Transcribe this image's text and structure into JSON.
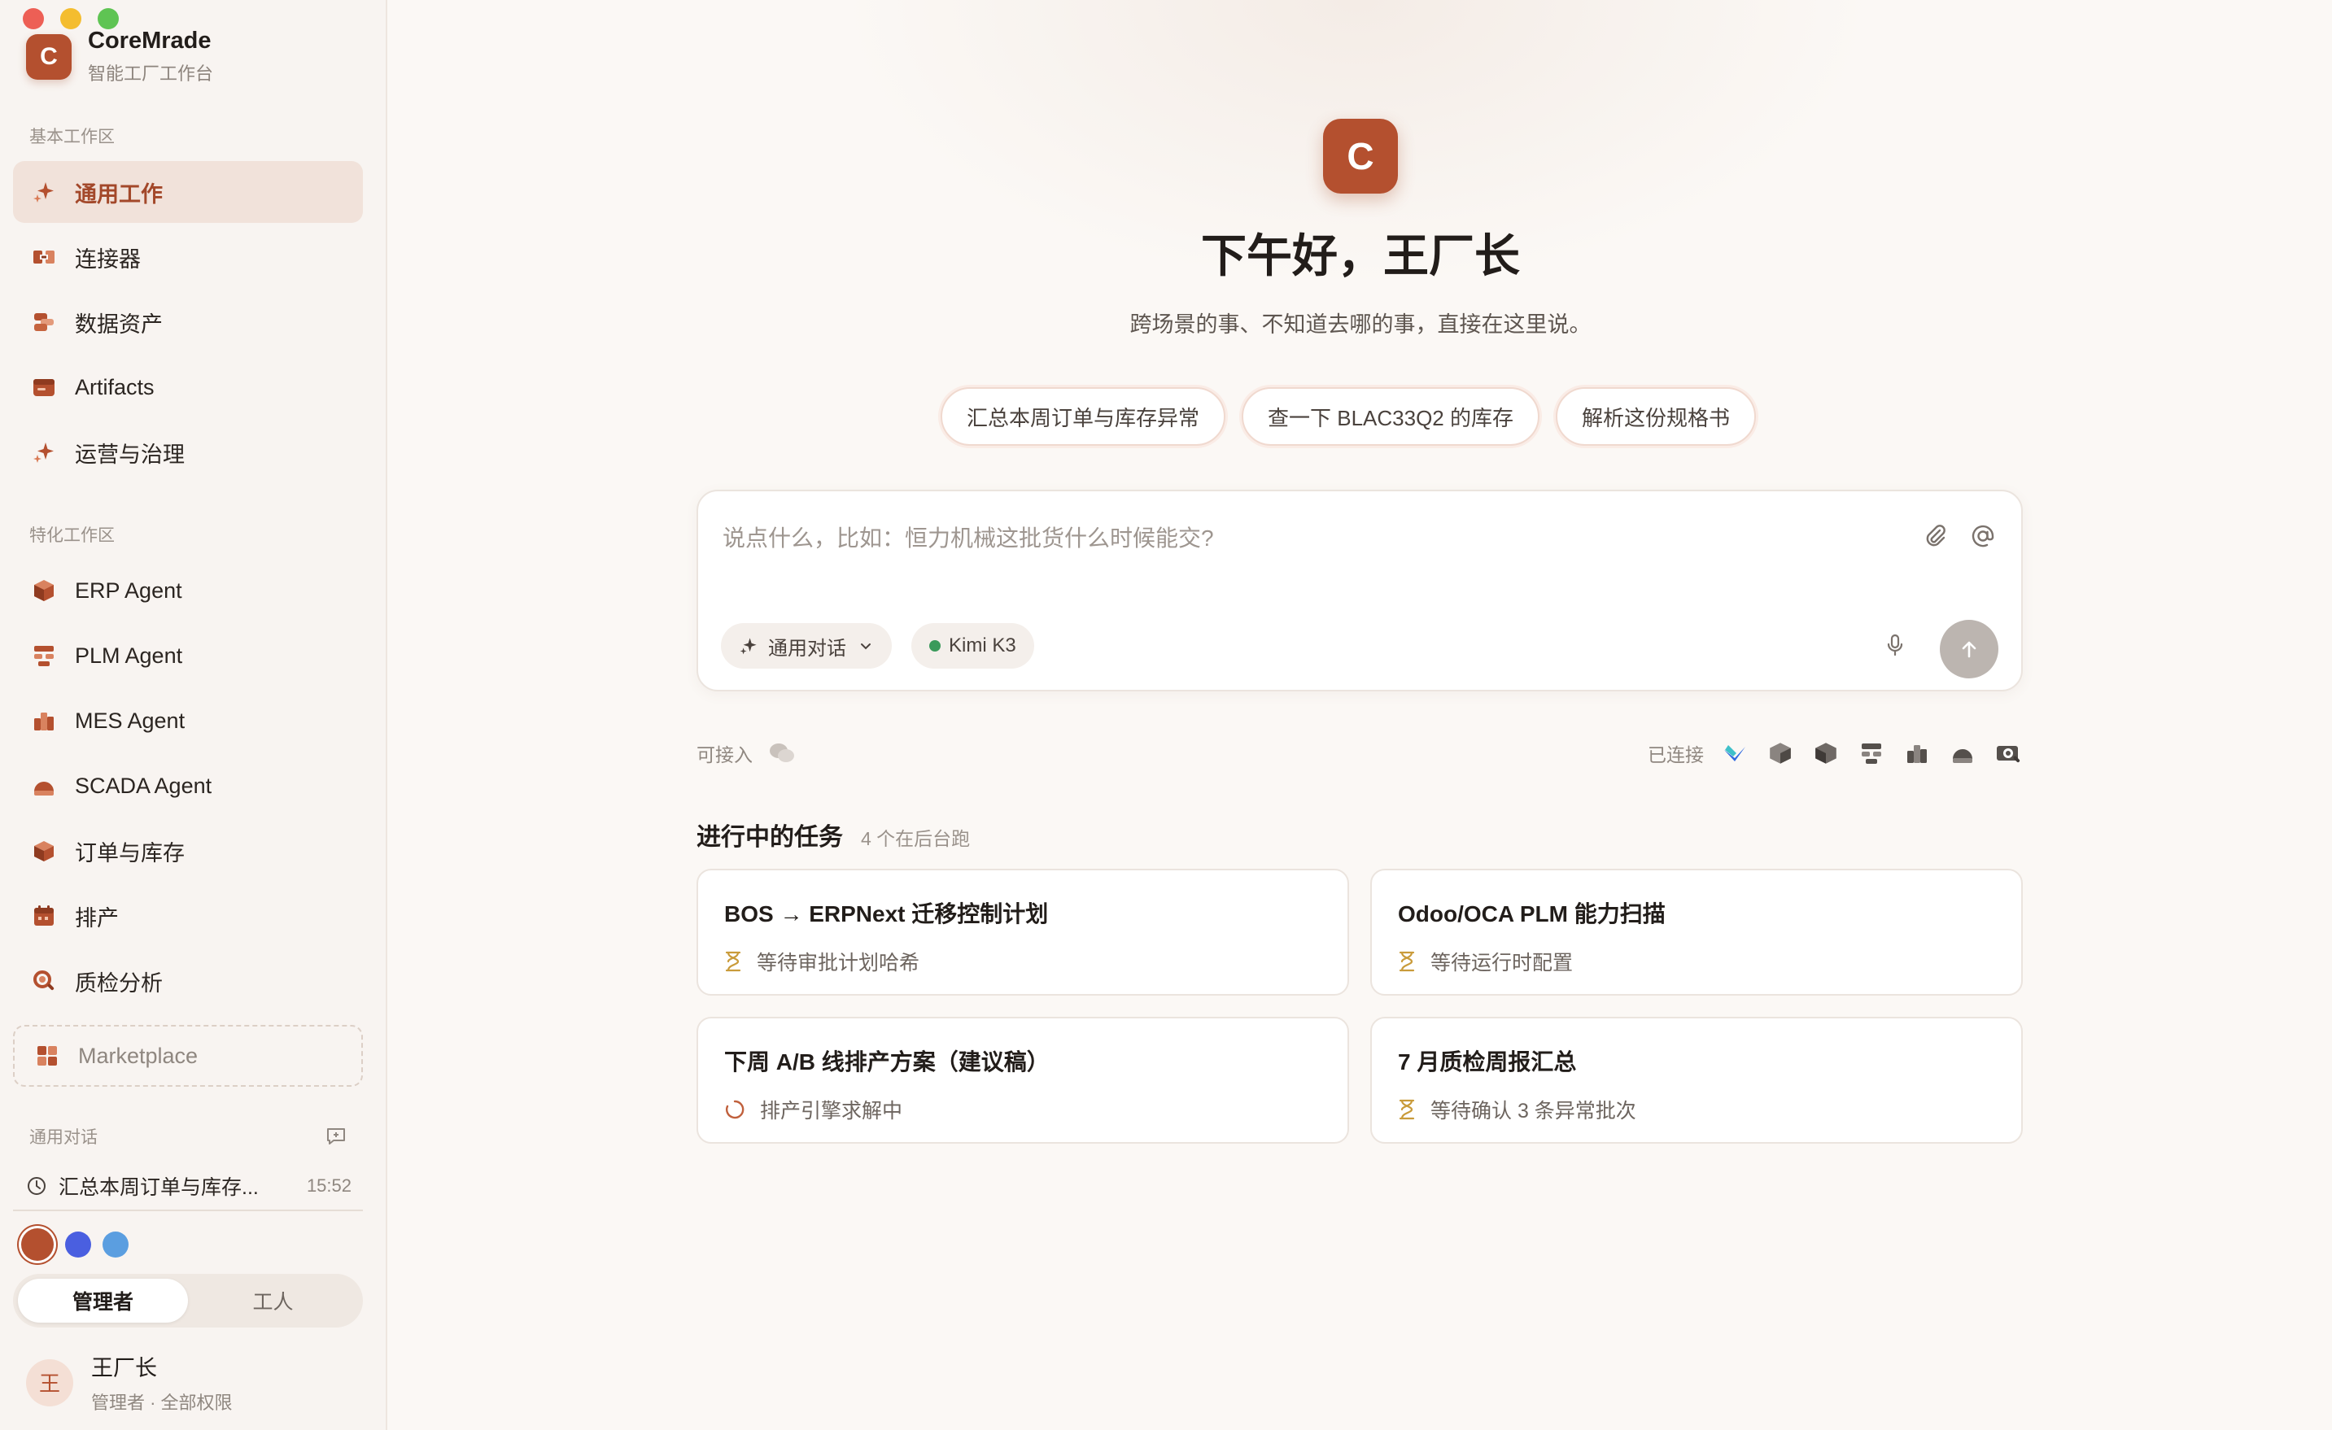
{
  "app": {
    "name": "CoreMrade",
    "subtitle": "智能工厂工作台",
    "logo_letter": "C",
    "accent": "#b4502f"
  },
  "sidebar": {
    "basic_section": "基本工作区",
    "basic_items": [
      {
        "label": "通用工作",
        "icon": "sparkle-icon",
        "active": true
      },
      {
        "label": "连接器",
        "icon": "connector-icon"
      },
      {
        "label": "数据资产",
        "icon": "data-asset-icon"
      },
      {
        "label": "Artifacts",
        "icon": "artifacts-icon"
      },
      {
        "label": "运营与治理",
        "icon": "sparkle-icon"
      }
    ],
    "special_section": "特化工作区",
    "special_items": [
      {
        "label": "ERP Agent",
        "icon": "cube-icon"
      },
      {
        "label": "PLM Agent",
        "icon": "plm-icon"
      },
      {
        "label": "MES Agent",
        "icon": "factory-icon"
      },
      {
        "label": "SCADA Agent",
        "icon": "gauge-icon"
      },
      {
        "label": "订单与库存",
        "icon": "box-icon"
      },
      {
        "label": "排产",
        "icon": "calendar-icon"
      },
      {
        "label": "质检分析",
        "icon": "magnifier-icon"
      }
    ],
    "marketplace": "Marketplace",
    "conversations_label": "通用对话",
    "conversations": [
      {
        "title": "汇总本周订单与库存...",
        "time": "15:52"
      }
    ],
    "theme_colors": [
      "#b4502f",
      "#4a5fe0",
      "#5b9ee0"
    ],
    "roles": [
      "管理者",
      "工人"
    ],
    "active_role": "管理者",
    "user": {
      "avatar": "王",
      "name": "王厂长",
      "role": "管理者 · 全部权限"
    }
  },
  "main": {
    "logo_letter": "C",
    "greeting": "下午好，王厂长",
    "subtitle": "跨场景的事、不知道去哪的事，直接在这里说。",
    "suggestions": [
      "汇总本周订单与库存异常",
      "查一下 BLAC33Q2 的库存",
      "解析这份规格书"
    ],
    "composer": {
      "placeholder": "说点什么，比如：恒力机械这批货什么时候能交?",
      "mode": "通用对话",
      "model": "Kimi K3",
      "model_status_color": "#3a9a5b"
    },
    "connect": {
      "available_label": "可接入",
      "connected_label": "已连接",
      "connected_icons": [
        "feishu-icon",
        "cube-icon",
        "cube-alt-icon",
        "plm-icon",
        "factory-icon",
        "gauge-icon",
        "magnifier-icon"
      ]
    },
    "tasks_title": "进行中的任务",
    "tasks_count": "4 个在后台跑",
    "tasks": [
      {
        "title": "BOS → ERPNext 迁移控制计划",
        "status": "等待审批计划哈希",
        "status_icon": "hourglass-icon"
      },
      {
        "title": "Odoo/OCA PLM 能力扫描",
        "status": "等待运行时配置",
        "status_icon": "hourglass-icon"
      },
      {
        "title": "下周 A/B 线排产方案（建议稿）",
        "status": "排产引擎求解中",
        "status_icon": "spinner-icon"
      },
      {
        "title": "7 月质检周报汇总",
        "status": "等待确认 3 条异常批次",
        "status_icon": "hourglass-icon"
      }
    ]
  }
}
